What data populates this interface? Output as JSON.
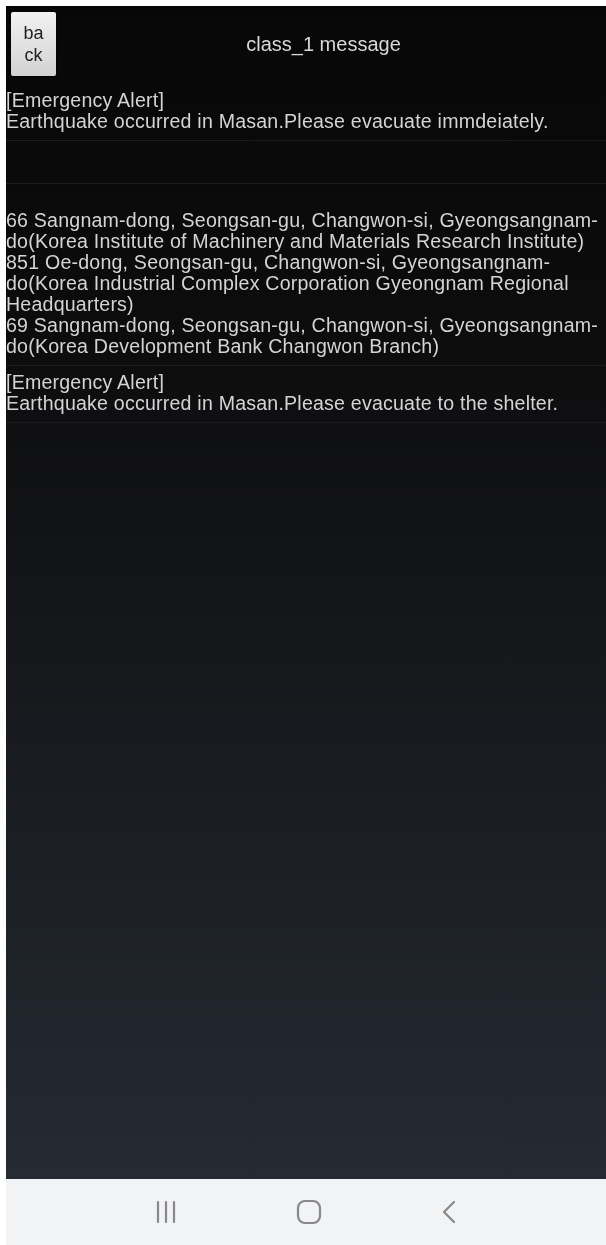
{
  "header": {
    "back_button": "back",
    "title": "class_1 message"
  },
  "messages": [
    {
      "kind": "alert",
      "lines": [
        "[Emergency Alert]",
        "Earthquake occurred in Masan.Please evacuate immdeiately."
      ]
    },
    {
      "kind": "blank"
    },
    {
      "kind": "addresses",
      "lines": [
        "66 Sangnam-dong, Seongsan-gu, Changwon-si, Gyeongsangnam-",
        "do(Korea Institute of Machinery and Materials Research Institute)",
        "851 Oe-dong, Seongsan-gu, Changwon-si, Gyeongsangnam-",
        "do(Korea Industrial Complex Corporation Gyeongnam Regional",
        "Headquarters)",
        "69 Sangnam-dong, Seongsan-gu, Changwon-si, Gyeongsangnam-",
        "do(Korea Development Bank Changwon Branch)"
      ]
    },
    {
      "kind": "alert",
      "lines": [
        "[Emergency Alert]",
        "Earthquake occurred in Masan.Please evacuate to the shelter."
      ]
    }
  ]
}
